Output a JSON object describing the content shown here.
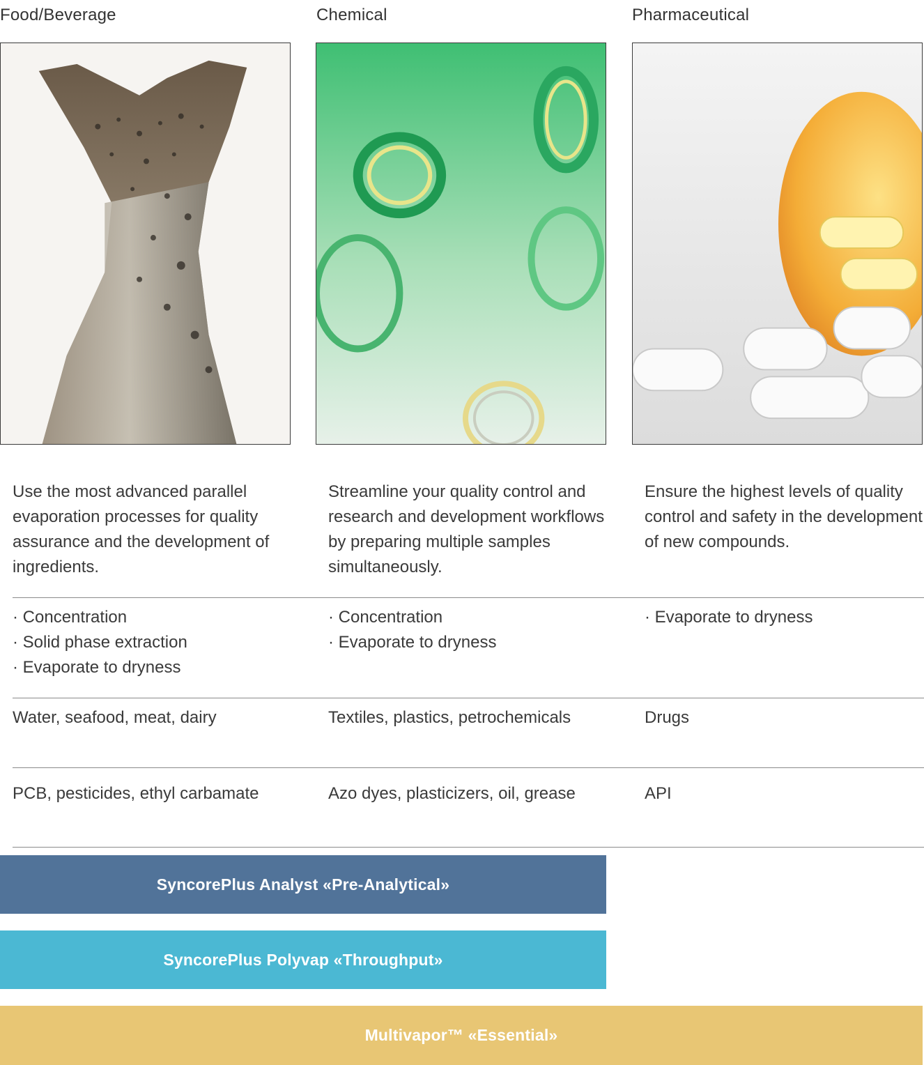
{
  "columns": [
    {
      "title": "Food/Beverage",
      "image_icon": "fish-tail-photo",
      "description": "Use the most advanced parallel evaporation processes for quality assurance and the development of ingredients.",
      "applications": [
        "Concentration",
        "Solid phase extraction",
        "Evaporate to dryness"
      ],
      "samples": "Water, seafood, meat, dairy",
      "analytes": "PCB, pesticides, ethyl carbamate"
    },
    {
      "title": "Chemical",
      "image_icon": "plastic-bottles-photo",
      "description": "Streamline your quality control and research and development workflows by preparing multiple samples simultaneously.",
      "applications": [
        "Concentration",
        "Evaporate to dryness"
      ],
      "samples": "Textiles, plastics, petrochemicals",
      "analytes": "Azo dyes, plasticizers, oil, grease"
    },
    {
      "title": "Pharmaceutical",
      "image_icon": "pill-bottle-photo",
      "description": "Ensure the highest levels of quality control and safety in the development of new compounds.",
      "applications": [
        "Evaporate to dryness"
      ],
      "samples": "Drugs",
      "analytes": "API"
    }
  ],
  "products": [
    {
      "label": "SyncorePlus Analyst «Pre-Analytical»",
      "color": "#517399"
    },
    {
      "label": "SyncorePlus Polyvap «Throughput»",
      "color": "#4bb8d3"
    },
    {
      "label": "Multivapor™ «Essential»",
      "color": "#e8c674"
    }
  ]
}
